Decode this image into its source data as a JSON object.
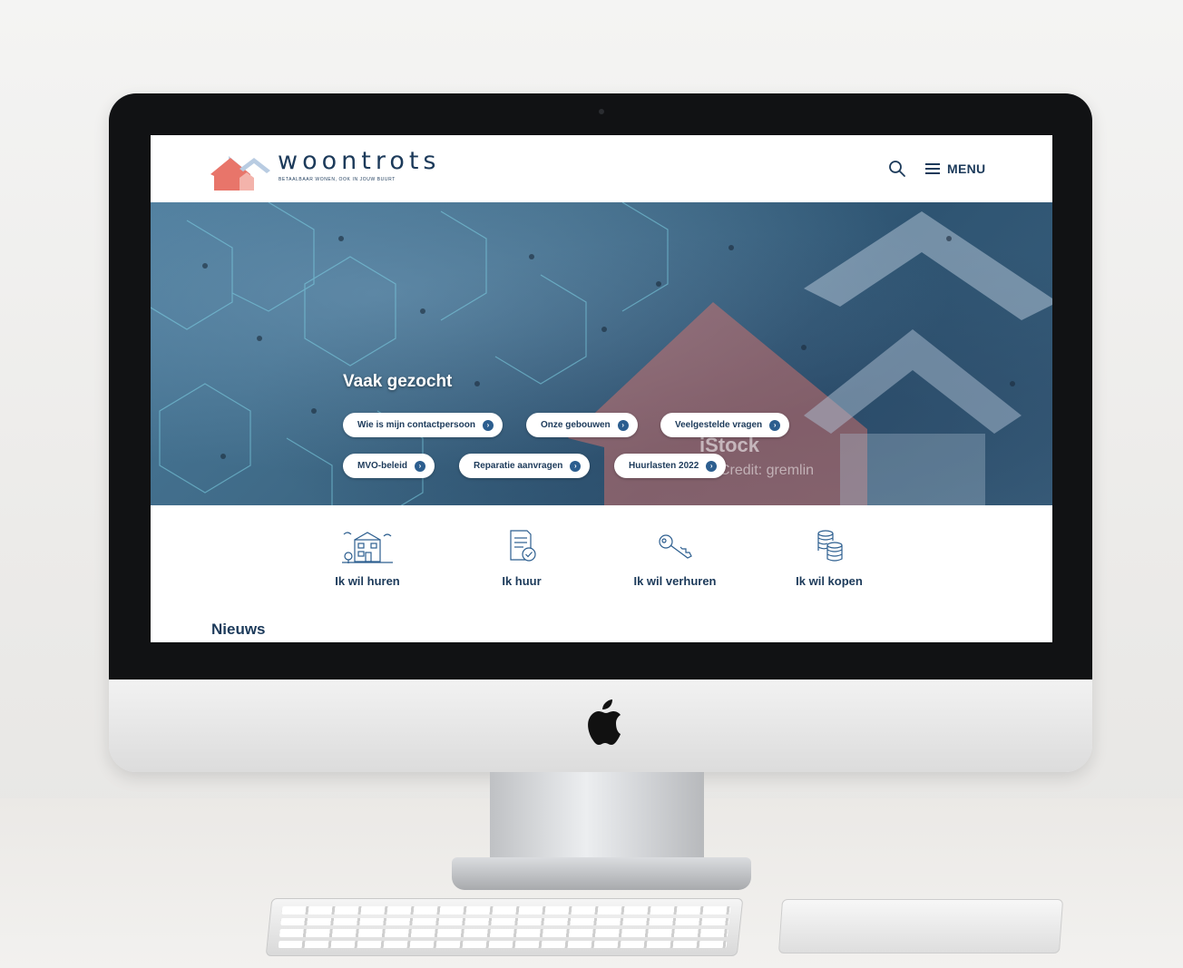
{
  "site": {
    "logo_name": "woontrots",
    "tagline": "BETAALBAAR WONEN, OOK IN JOUW BUURT",
    "menu_label": "MENU"
  },
  "hero": {
    "title": "Vaak gezocht",
    "links": [
      {
        "label": "Wie is mijn contactpersoon"
      },
      {
        "label": "Onze gebouwen"
      },
      {
        "label": "Veelgestelde vragen"
      },
      {
        "label": "MVO-beleid"
      },
      {
        "label": "Reparatie aanvragen"
      },
      {
        "label": "Huurlasten 2022"
      }
    ],
    "watermark": "iStock",
    "watermark_credit": "Credit: gremlin"
  },
  "quick_links": [
    {
      "label": "Ik wil huren",
      "icon": "building-icon"
    },
    {
      "label": "Ik huur",
      "icon": "document-check-icon"
    },
    {
      "label": "Ik wil verhuren",
      "icon": "key-icon"
    },
    {
      "label": "Ik wil kopen",
      "icon": "coins-icon"
    }
  ],
  "news": {
    "title": "Nieuws"
  },
  "colors": {
    "brand_navy": "#1c3a5a",
    "brand_red": "#e8756a",
    "brand_light_blue": "#b9cce2",
    "link_dot": "#2c5e8f"
  }
}
